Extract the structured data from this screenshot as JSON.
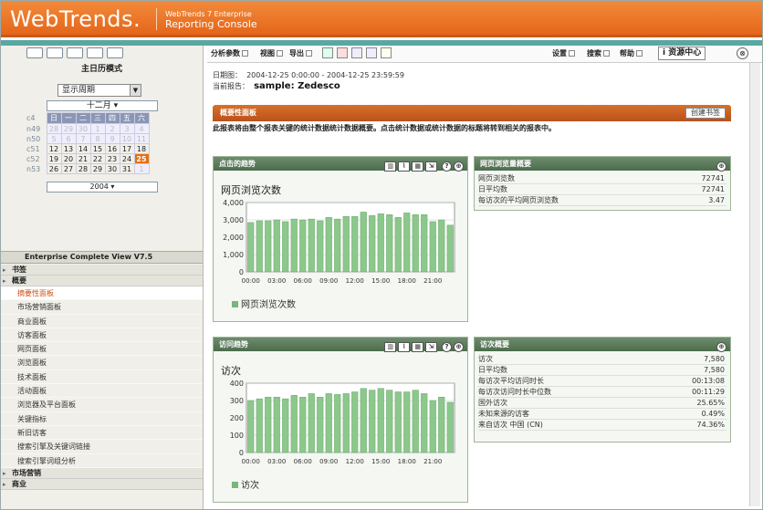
{
  "header": {
    "logo": "WebTrends",
    "logo_dot": ".",
    "sub1": "WebTrends 7 Enterprise",
    "sub2": "Reporting Console"
  },
  "left": {
    "toolbar_label": "主日历模式",
    "period_select": "显示周期",
    "month": "十二月",
    "year": "2004",
    "weekday_headers": [
      "日",
      "一",
      "二",
      "三",
      "四",
      "五",
      "六"
    ],
    "week_labels": [
      "c4",
      "n49",
      "n50",
      "c51",
      "c52",
      "n53"
    ],
    "weeks": [
      [
        "28",
        "29",
        "30",
        "1",
        "2",
        "3",
        "4"
      ],
      [
        "5",
        "6",
        "7",
        "8",
        "9",
        "10",
        "11"
      ],
      [
        "12",
        "13",
        "14",
        "15",
        "16",
        "17",
        "18"
      ],
      [
        "19",
        "20",
        "21",
        "22",
        "23",
        "24",
        "25"
      ],
      [
        "26",
        "27",
        "28",
        "29",
        "30",
        "31",
        "1"
      ]
    ],
    "current_day": "25",
    "profile_header": "Enterprise Complete View V7.5",
    "nav": [
      {
        "type": "section",
        "label": "书签"
      },
      {
        "type": "section",
        "label": "概要"
      },
      {
        "type": "item",
        "label": "摘要性面板",
        "active": true
      },
      {
        "type": "item",
        "label": "市场营销面板"
      },
      {
        "type": "item",
        "label": "商业面板"
      },
      {
        "type": "item",
        "label": "访客面板"
      },
      {
        "type": "item",
        "label": "网页面板"
      },
      {
        "type": "item",
        "label": "浏览面板"
      },
      {
        "type": "item",
        "label": "技术面板"
      },
      {
        "type": "item",
        "label": "活动面板"
      },
      {
        "type": "item",
        "label": "浏览器及平台面板"
      },
      {
        "type": "item",
        "label": "关键指标"
      },
      {
        "type": "item",
        "label": "新旧访客"
      },
      {
        "type": "item",
        "label": "搜索引擎及关键词链接"
      },
      {
        "type": "item",
        "label": "搜索引擎词组分析"
      },
      {
        "type": "section",
        "label": "市场营销"
      },
      {
        "type": "section",
        "label": "商业"
      }
    ]
  },
  "toolbar": {
    "items": [
      "分析参数",
      "视图",
      "导出",
      "设置",
      "搜索",
      "帮助"
    ],
    "help_center": "i 资源中心"
  },
  "main": {
    "date_label": "日期图：",
    "date_value": "2004-12-25 0:00:00 - 2004-12-25 23:59:59",
    "report_label": "当前报告：",
    "report_value": "sample: Zedesco",
    "banner": "概要性面板",
    "banner_button": "创建书签",
    "description": "此报表将由整个报表关键的统计数据统计数据概要。点击统计数据或统计数据的标题将转到相关的报表中。"
  },
  "panel_hits": {
    "title": "点击的趋势",
    "chart_title": "网页浏览次数",
    "legend": "网页浏览次数"
  },
  "panel_visits": {
    "title": "访问趋势",
    "chart_title": "访次",
    "legend": "访次"
  },
  "stats_pages": {
    "title": "网页浏览量概要",
    "rows": [
      {
        "label": "网页浏览数",
        "value": "72741"
      },
      {
        "label": "日平均数",
        "value": "72741"
      },
      {
        "label": "每访次的平均网页浏览数",
        "value": "3.47"
      }
    ]
  },
  "stats_visits": {
    "title": "访次概要",
    "rows": [
      {
        "label": "访次",
        "value": "7,580"
      },
      {
        "label": "日平均数",
        "value": "7,580"
      },
      {
        "label": "每访次平均访问时长",
        "value": "00:13:08"
      },
      {
        "label": "每访次访问时长中位数",
        "value": "00:11:29"
      },
      {
        "label": "国外访次",
        "value": "25.65%"
      },
      {
        "label": "未知来源的访客",
        "value": "0.49%"
      },
      {
        "label": "来自访次 中国 (CN)",
        "value": "74.36%"
      }
    ]
  },
  "chart_data": [
    {
      "type": "bar",
      "title": "网页浏览次数",
      "categories": [
        "00:00",
        "01:00",
        "02:00",
        "03:00",
        "04:00",
        "05:00",
        "06:00",
        "07:00",
        "08:00",
        "09:00",
        "10:00",
        "11:00",
        "12:00",
        "13:00",
        "14:00",
        "15:00",
        "16:00",
        "17:00",
        "18:00",
        "19:00",
        "20:00",
        "21:00",
        "22:00",
        "23:00"
      ],
      "xticks": [
        "00:00",
        "03:00",
        "06:00",
        "09:00",
        "12:00",
        "15:00",
        "18:00",
        "21:00"
      ],
      "values": [
        2850,
        2950,
        2950,
        3000,
        2900,
        3050,
        3000,
        3050,
        2950,
        3150,
        3050,
        3200,
        3200,
        3450,
        3250,
        3350,
        3300,
        3150,
        3400,
        3300,
        3300,
        2900,
        3000,
        2700
      ],
      "ylim": [
        0,
        4000
      ],
      "yticks": [
        "0",
        "1,000",
        "2,000",
        "3,000",
        "4,000"
      ],
      "series": [
        {
          "name": "网页浏览次数"
        }
      ]
    },
    {
      "type": "bar",
      "title": "访次",
      "categories": [
        "00:00",
        "01:00",
        "02:00",
        "03:00",
        "04:00",
        "05:00",
        "06:00",
        "07:00",
        "08:00",
        "09:00",
        "10:00",
        "11:00",
        "12:00",
        "13:00",
        "14:00",
        "15:00",
        "16:00",
        "17:00",
        "18:00",
        "19:00",
        "20:00",
        "21:00",
        "22:00",
        "23:00"
      ],
      "xticks": [
        "00:00",
        "03:00",
        "06:00",
        "09:00",
        "12:00",
        "15:00",
        "18:00",
        "21:00"
      ],
      "values": [
        300,
        310,
        320,
        320,
        310,
        330,
        320,
        340,
        320,
        340,
        335,
        340,
        350,
        370,
        360,
        370,
        360,
        350,
        350,
        360,
        340,
        300,
        320,
        290
      ],
      "ylim": [
        0,
        400
      ],
      "yticks": [
        "0",
        "100",
        "200",
        "300",
        "400"
      ],
      "series": [
        {
          "name": "访次"
        }
      ]
    }
  ]
}
